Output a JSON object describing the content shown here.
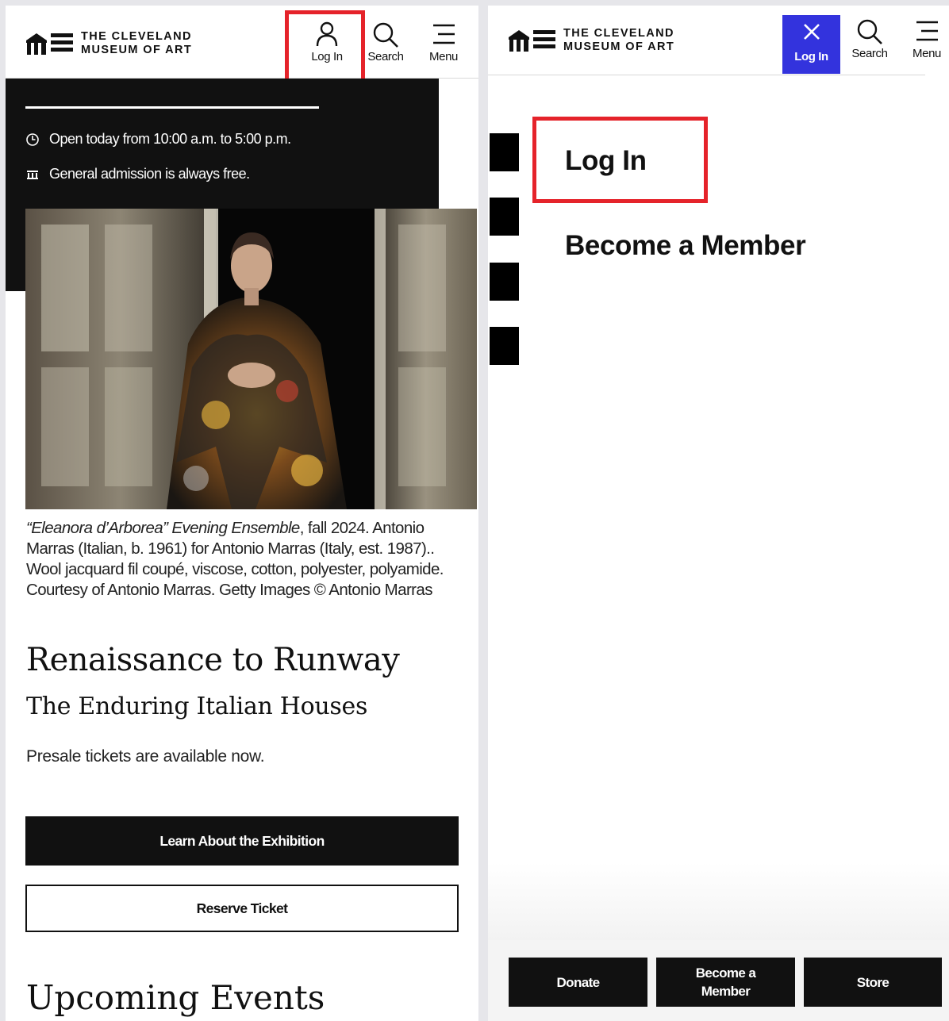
{
  "brand": {
    "line1": "THE CLEVELAND",
    "line2": "MUSEUM OF ART"
  },
  "header": {
    "login_label": "Log In",
    "search_label": "Search",
    "menu_label": "Menu"
  },
  "info": {
    "hours": "Open today from 10:00 a.m. to 5:00 p.m.",
    "admission": "General admission is always free."
  },
  "caption": {
    "title": "“Eleanora d’Arborea” Evening Ensemble",
    "rest": ", fall 2024. Antonio Marras (Italian, b. 1961) for Antonio Marras (Italy, est. 1987).. Wool jacquard fil coupé, viscose, cotton, polyester, polyamide. Courtesy of Antonio Marras. Getty Images © Antonio Marras"
  },
  "exhibition": {
    "title": "Renaissance to Runway",
    "subtitle": "The Enduring Italian Houses",
    "presale": "Presale tickets are available now.",
    "learn_label": "Learn About the Exhibition",
    "reserve_label": "Reserve Ticket"
  },
  "upcoming_heading": "Upcoming Events",
  "login_menu": {
    "items": [
      "Log In",
      "Become a Member"
    ]
  },
  "footer": {
    "donate": "Donate",
    "member_line1": "Become a",
    "member_line2": "Member",
    "store": "Store"
  },
  "colors": {
    "accent_blue": "#3333dd",
    "highlight_red": "#e5232a",
    "dark": "#111111"
  }
}
